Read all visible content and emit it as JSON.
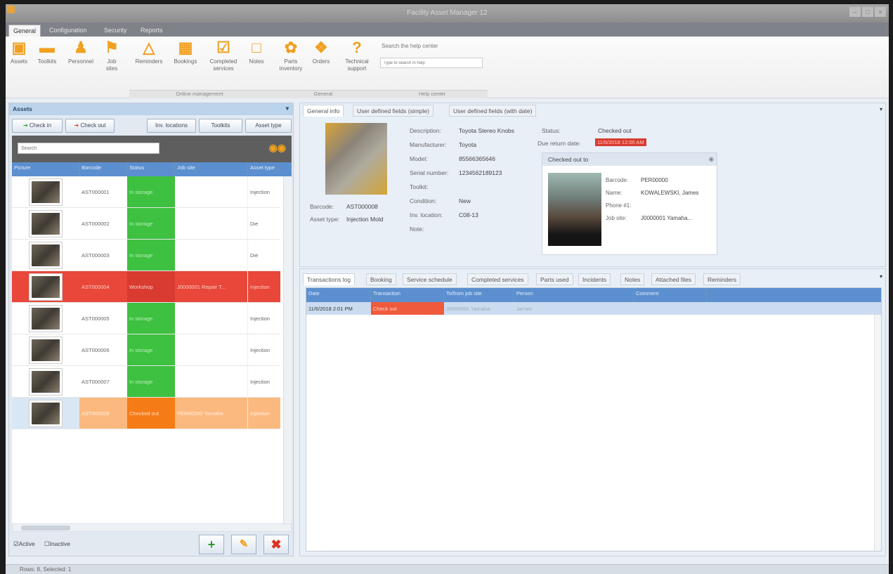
{
  "window": {
    "title": "Facility Asset Manager 12"
  },
  "menu_tabs": [
    "General",
    "Configuration",
    "Security",
    "Reports"
  ],
  "ribbon": {
    "buttons": [
      {
        "label": "Assets",
        "icon": "assets-icon"
      },
      {
        "label": "Toolkits",
        "icon": "toolkits-icon"
      },
      {
        "label": "Personnel",
        "icon": "personnel-icon"
      },
      {
        "label": "Job sites",
        "icon": "job-sites-icon"
      },
      {
        "label": "Reminders",
        "icon": "reminders-icon"
      },
      {
        "label": "Bookings",
        "icon": "bookings-icon"
      },
      {
        "label": "Completed services",
        "icon": "completed-services-icon"
      },
      {
        "label": "Notes",
        "icon": "notes-icon"
      },
      {
        "label": "Parts inventory",
        "icon": "parts-inventory-icon"
      },
      {
        "label": "Orders",
        "icon": "orders-icon"
      },
      {
        "label": "Technical support",
        "icon": "technical-support-icon"
      }
    ],
    "groups": [
      "Online management",
      "General",
      "Help center"
    ],
    "help_search_label": "Search the help center",
    "help_search_placeholder": "Type to search in help"
  },
  "assets_panel": {
    "title": "Assets",
    "buttons": {
      "check_in": "Check in",
      "check_out": "Check out",
      "inv_locations": "Inv. locations",
      "toolkits": "Toolkits",
      "asset_type": "Asset type"
    },
    "search_placeholder": "Search",
    "columns": [
      "Picture",
      "Barcode",
      "Status",
      "Job site",
      "Asset type"
    ],
    "rows": [
      {
        "barcode": "AST000001",
        "status": "In storage",
        "job_site": "",
        "asset_type": "Injection",
        "style": "green"
      },
      {
        "barcode": "AST000002",
        "status": "In storage",
        "job_site": "",
        "asset_type": "Die",
        "style": "green"
      },
      {
        "barcode": "AST000003",
        "status": "In storage",
        "job_site": "",
        "asset_type": "Die",
        "style": "green"
      },
      {
        "barcode": "AST000004",
        "status": "Workshop",
        "job_site": "J0000001 Repair T...",
        "asset_type": "Injection",
        "style": "red"
      },
      {
        "barcode": "AST000005",
        "status": "In storage",
        "job_site": "",
        "asset_type": "Injection",
        "style": "green"
      },
      {
        "barcode": "AST000006",
        "status": "In storage",
        "job_site": "",
        "asset_type": "Injection",
        "style": "green"
      },
      {
        "barcode": "AST000007",
        "status": "In storage",
        "job_site": "",
        "asset_type": "Injection",
        "style": "green"
      },
      {
        "barcode": "AST000008",
        "status": "Checked out",
        "job_site": "PER00000 Yamaha",
        "asset_type": "Injection",
        "style": "orange"
      }
    ],
    "filters": {
      "active": "Active",
      "inactive": "Inactive"
    }
  },
  "detail": {
    "tabs": [
      "General info",
      "User defined fields (simple)",
      "User defined fields (with date)"
    ],
    "barcode_label": "Barcode:",
    "barcode": "AST000008",
    "asset_type_label": "Asset type:",
    "asset_type": "Injection Mold",
    "fields": [
      {
        "label": "Description:",
        "value": "Toyota Stereo Knobs"
      },
      {
        "label": "Manufacturer:",
        "value": "Toyota"
      },
      {
        "label": "Model:",
        "value": "85566365646"
      },
      {
        "label": "Serial number:",
        "value": "1234562189123"
      },
      {
        "label": "Toolkit:",
        "value": ""
      },
      {
        "label": "Condition:",
        "value": "New"
      },
      {
        "label": "Inv. location:",
        "value": "C08-13"
      },
      {
        "label": "Note:",
        "value": ""
      }
    ],
    "status_label": "Status:",
    "status": "Checked out",
    "due_label": "Due return date:",
    "due": "11/6/2018 12:00 AM",
    "checked_out_to": {
      "title": "Checked out to",
      "rows": [
        {
          "label": "Barcode:",
          "value": "PER00000"
        },
        {
          "label": "Name:",
          "value": "KOWALEWSKI, James"
        },
        {
          "label": "Phone #1:",
          "value": ""
        },
        {
          "label": "Job site:",
          "value": "J0000001 Yamaha..."
        }
      ]
    }
  },
  "log": {
    "tabs": [
      "Transactions log",
      "Booking",
      "Service schedule",
      "Completed services",
      "Parts used",
      "Incidents",
      "Notes",
      "Attached files",
      "Reminders"
    ],
    "columns": [
      "Date",
      "Transaction",
      "To/from job site",
      "Person",
      "Comment"
    ],
    "rows": [
      {
        "date": "11/6/2018 2:01 PM",
        "transaction": "Check out",
        "job_site": "J0000001 Yamaha",
        "person": "James",
        "comment": ""
      }
    ]
  },
  "status_bar": {
    "text": "Rows: 8, Selected: 1"
  },
  "colors": {
    "green": "#3ec041",
    "red": "#d93b30",
    "orange": "#f57b16",
    "header_blue": "#5b8fcf"
  }
}
